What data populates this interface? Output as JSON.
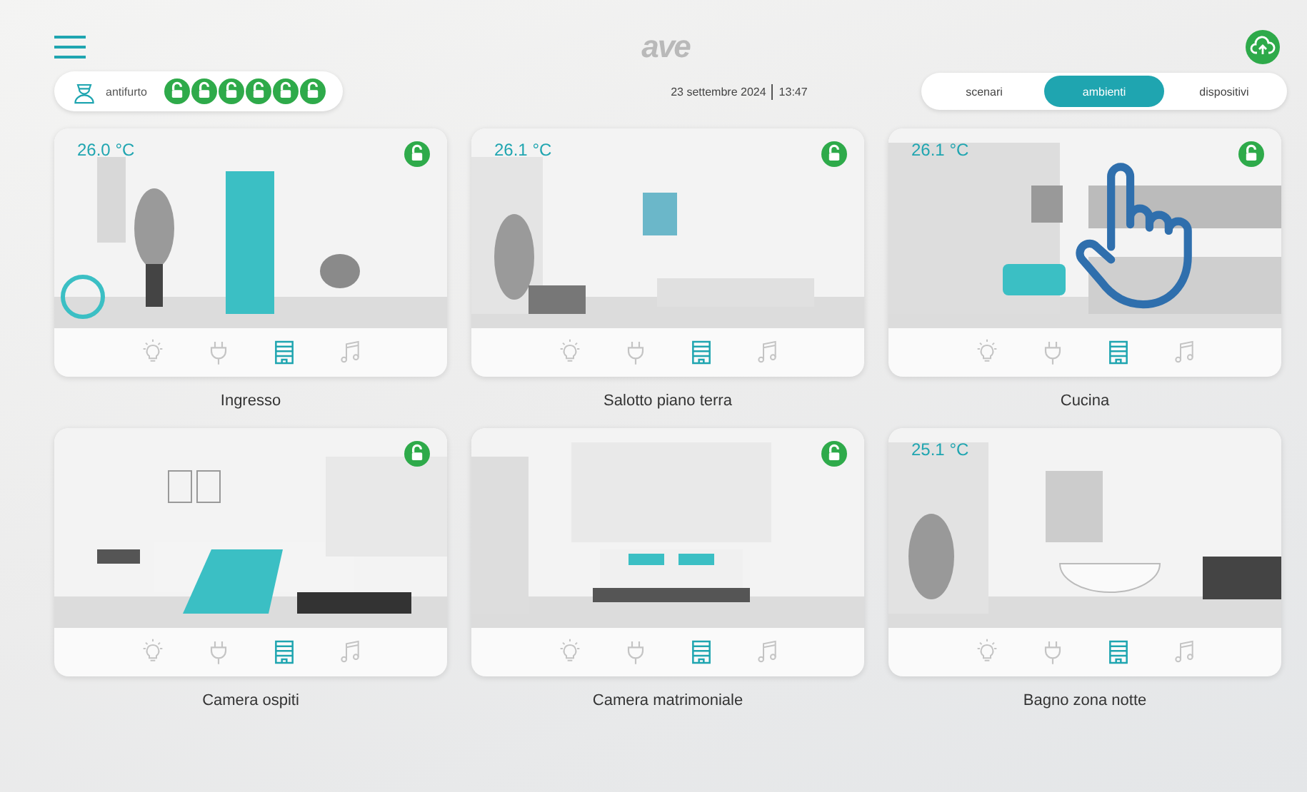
{
  "header": {
    "logo": "ave"
  },
  "alarm": {
    "label": "antifurto",
    "zones": [
      {
        "armed": false
      },
      {
        "armed": false
      },
      {
        "armed": false
      },
      {
        "armed": false
      },
      {
        "armed": false
      },
      {
        "armed": false
      }
    ]
  },
  "datetime": {
    "date": "23 settembre 2024",
    "time": "13:47"
  },
  "tabs": [
    {
      "label": "scenari",
      "selected": false
    },
    {
      "label": "ambienti",
      "selected": true
    },
    {
      "label": "dispositivi",
      "selected": false
    }
  ],
  "rooms": [
    {
      "name": "Ingresso",
      "temperature": "26.0 °C",
      "zone_locked": false,
      "devices": [
        {
          "kind": "light",
          "active": false
        },
        {
          "kind": "plug",
          "active": false
        },
        {
          "kind": "shutter",
          "active": true
        },
        {
          "kind": "music",
          "active": false
        }
      ]
    },
    {
      "name": "Salotto piano terra",
      "temperature": "26.1 °C",
      "zone_locked": false,
      "devices": [
        {
          "kind": "light",
          "active": false
        },
        {
          "kind": "plug",
          "active": false
        },
        {
          "kind": "shutter",
          "active": true
        },
        {
          "kind": "music",
          "active": false
        }
      ]
    },
    {
      "name": "Cucina",
      "temperature": "26.1 °C",
      "zone_locked": false,
      "devices": [
        {
          "kind": "light",
          "active": false
        },
        {
          "kind": "plug",
          "active": false
        },
        {
          "kind": "shutter",
          "active": true
        },
        {
          "kind": "music",
          "active": false
        }
      ]
    },
    {
      "name": "Camera ospiti",
      "zone_locked": false,
      "devices": [
        {
          "kind": "light",
          "active": false
        },
        {
          "kind": "plug",
          "active": false
        },
        {
          "kind": "shutter",
          "active": true
        },
        {
          "kind": "music",
          "active": false
        }
      ]
    },
    {
      "name": "Camera matrimoniale",
      "zone_locked": false,
      "devices": [
        {
          "kind": "light",
          "active": false
        },
        {
          "kind": "plug",
          "active": false
        },
        {
          "kind": "shutter",
          "active": true
        },
        {
          "kind": "music",
          "active": false
        }
      ]
    },
    {
      "name": "Bagno zona notte",
      "temperature": "25.1 °C",
      "devices": [
        {
          "kind": "light",
          "active": false
        },
        {
          "kind": "plug",
          "active": false
        },
        {
          "kind": "shutter",
          "active": true
        },
        {
          "kind": "music",
          "active": false
        }
      ]
    }
  ]
}
